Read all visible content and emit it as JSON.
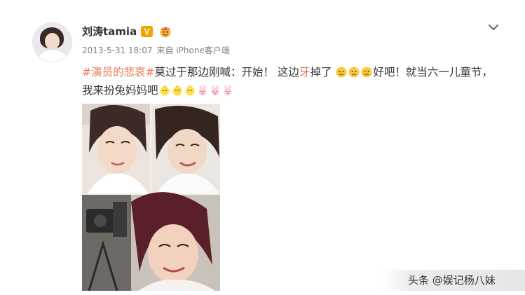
{
  "post": {
    "author": "刘涛tamia",
    "verified_badge": "V",
    "meta": {
      "date": "2013-5-31 18:07",
      "source": "来自 iPhone客户端"
    },
    "text": {
      "topic": "#演员的悲哀#",
      "part1": "莫过于那边刚喊：开始！ 这边",
      "highlight": "牙",
      "part2": "掉了",
      "part3": "好吧！就当六一儿童节，我来扮兔妈妈吧"
    },
    "icons": {
      "more": "chevron-down-icon",
      "member": "member-crown-icon",
      "emoji_sad": "sad-face-emoji",
      "emoji_chick": "chick-emoji",
      "emoji_bunny": "bunny-emoji"
    },
    "colors": {
      "topic": "#eb7350",
      "verified": "#f5a300",
      "meta_text": "#808080"
    }
  },
  "watermark": {
    "source": "头条 @娱记杨八妹"
  }
}
